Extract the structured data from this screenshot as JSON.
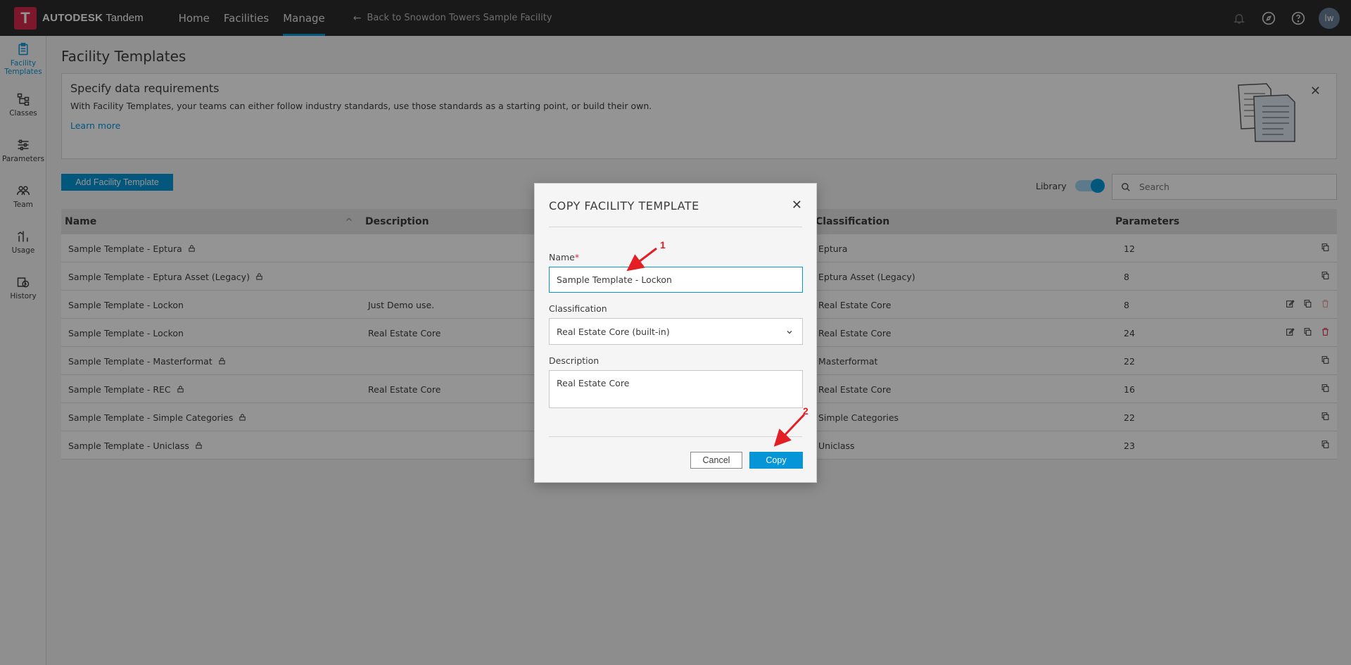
{
  "app": {
    "logo_letter": "T",
    "brand": "AUTODESK",
    "product": "Tandem"
  },
  "topnav": {
    "items": [
      {
        "label": "Home"
      },
      {
        "label": "Facilities"
      },
      {
        "label": "Manage"
      }
    ],
    "back_label": "Back to Snowdon Towers Sample Facility",
    "avatar_initials": "lw"
  },
  "sidebar": {
    "items": [
      {
        "label": "Facility Templates"
      },
      {
        "label": "Classes"
      },
      {
        "label": "Parameters"
      },
      {
        "label": "Team"
      },
      {
        "label": "Usage"
      },
      {
        "label": "History"
      }
    ]
  },
  "page": {
    "title": "Facility Templates"
  },
  "banner": {
    "title": "Specify data requirements",
    "text": "With Facility Templates, your teams can either follow industry standards, use those standards as a starting point, or build their own.",
    "link": "Learn more"
  },
  "toolbar": {
    "add_label": "Add Facility Template",
    "library_label": "Library",
    "search_placeholder": "Search"
  },
  "table": {
    "headers": {
      "name": "Name",
      "description": "Description",
      "classification": "Classification",
      "parameters": "Parameters"
    },
    "rows": [
      {
        "name": "Sample Template - Eptura",
        "description": "",
        "classification": "Eptura",
        "parameters": "12"
      },
      {
        "name": "Sample Template - Eptura Asset (Legacy)",
        "description": "",
        "classification": "Eptura Asset (Legacy)",
        "parameters": "8"
      },
      {
        "name": "Sample Template - Lockon",
        "description": "Just Demo use.",
        "classification": "Real Estate Core",
        "parameters": "8"
      },
      {
        "name": "Sample Template - Lockon",
        "description": "Real Estate Core",
        "classification": "Real Estate Core",
        "parameters": "24"
      },
      {
        "name": "Sample Template - Masterformat",
        "description": "",
        "classification": "Masterformat",
        "parameters": "22"
      },
      {
        "name": "Sample Template - REC",
        "description": "Real Estate Core",
        "classification": "Real Estate Core",
        "parameters": "16"
      },
      {
        "name": "Sample Template - Simple Categories",
        "description": "",
        "classification": "Simple Categories",
        "parameters": "22"
      },
      {
        "name": "Sample Template - Uniclass",
        "description": "",
        "classification": "Uniclass",
        "parameters": "23"
      }
    ]
  },
  "modal": {
    "title": "COPY FACILITY TEMPLATE",
    "name_label": "Name",
    "name_required": "*",
    "name_value": "Sample Template - Lockon",
    "classification_label": "Classification",
    "classification_value": "Real Estate Core (built-in)",
    "description_label": "Description",
    "description_value": "Real Estate Core",
    "cancel_label": "Cancel",
    "copy_label": "Copy"
  },
  "annotations": {
    "step1": "1",
    "step2": "2"
  },
  "colors": {
    "accent": "#0696d7",
    "brand": "#d7294c",
    "annotation": "#e31e24"
  }
}
